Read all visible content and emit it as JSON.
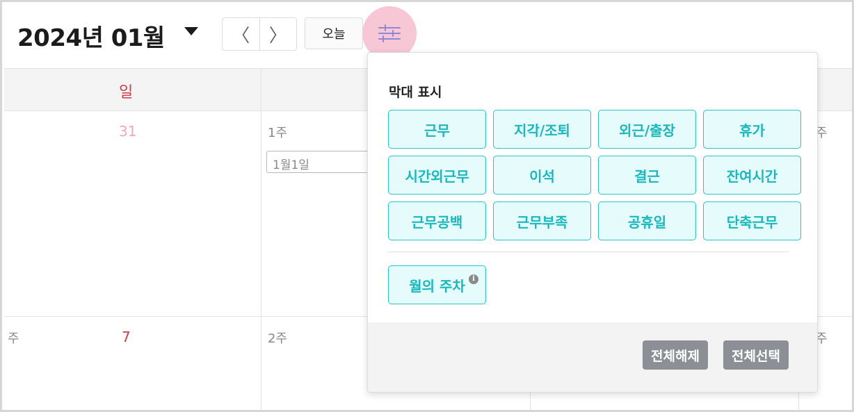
{
  "header": {
    "month_title": "2024년 01월",
    "prev_label": "〈",
    "next_label": "〉",
    "today_label": "오늘"
  },
  "calendar": {
    "weekday_sun": "일",
    "days": {
      "d31": "31",
      "d7": "7"
    },
    "weeks": {
      "w1": "1주",
      "w2": "2주",
      "right_w1": "주",
      "right_w2": "주",
      "left_w2": "주"
    },
    "event_chip": "1월1일"
  },
  "panel": {
    "heading": "막대 표시",
    "options": [
      "근무",
      "지각/조퇴",
      "외근/출장",
      "휴가",
      "시간외근무",
      "이석",
      "결근",
      "잔여시간",
      "근무공백",
      "근무부족",
      "공휴일",
      "단축근무"
    ],
    "week_option": "월의 주차",
    "info_glyph": "i",
    "deselect_all": "전체해제",
    "select_all": "전체선택"
  },
  "colors": {
    "accent": "#17b9bd",
    "option_bg": "#e6fbfb",
    "sunday": "#d13b49",
    "filter_highlight": "#f7c7d6",
    "footer_button": "#8c8f96"
  },
  "icons": {
    "filter": "sliders-icon",
    "dropdown": "caret-down-icon"
  }
}
